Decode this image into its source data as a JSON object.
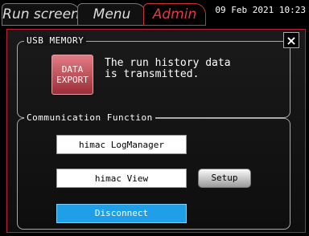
{
  "tabs": {
    "run": "Run screen",
    "menu": "Menu",
    "admin": "Admin"
  },
  "datetime": "09 Feb 2021 10:23",
  "close_icon": "×",
  "usb": {
    "legend": "USB MEMORY",
    "data_export_line1": "DATA",
    "data_export_line2": "EXPORT",
    "message_line1": "The run history data",
    "message_line2": "is transmitted."
  },
  "comm": {
    "legend": "Communication Function",
    "logmanager": "himac LogManager",
    "view": "himac View",
    "setup": "Setup",
    "disconnect": "Disconnect"
  }
}
